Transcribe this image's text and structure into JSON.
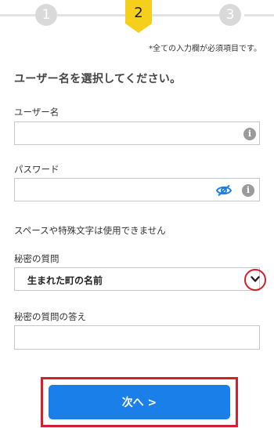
{
  "steps": [
    {
      "number": "1",
      "state": "inactive"
    },
    {
      "number": "2",
      "state": "current"
    },
    {
      "number": "3",
      "state": "inactive"
    }
  ],
  "required_note": "*全ての入力欄が必須項目です。",
  "heading": "ユーザー名を選択してください。",
  "username": {
    "label": "ユーザー名",
    "value": "",
    "info_icon": "info-icon"
  },
  "password": {
    "label": "パスワード",
    "value": "",
    "toggle_icon": "eye-slash-icon",
    "info_icon": "info-icon"
  },
  "password_hint": "スペースや特殊文字は使用できません",
  "secret_question": {
    "label": "秘密の質問",
    "selected": "生まれた町の名前",
    "icon": "chevron-down-icon"
  },
  "secret_answer": {
    "label": "秘密の質問の答え",
    "value": ""
  },
  "next_button": {
    "label": "次へ >"
  },
  "colors": {
    "accent": "#1a7fe8",
    "step_current": "#f5cf1c",
    "highlight": "#d3202c",
    "step_inactive": "#d9d9d9"
  }
}
